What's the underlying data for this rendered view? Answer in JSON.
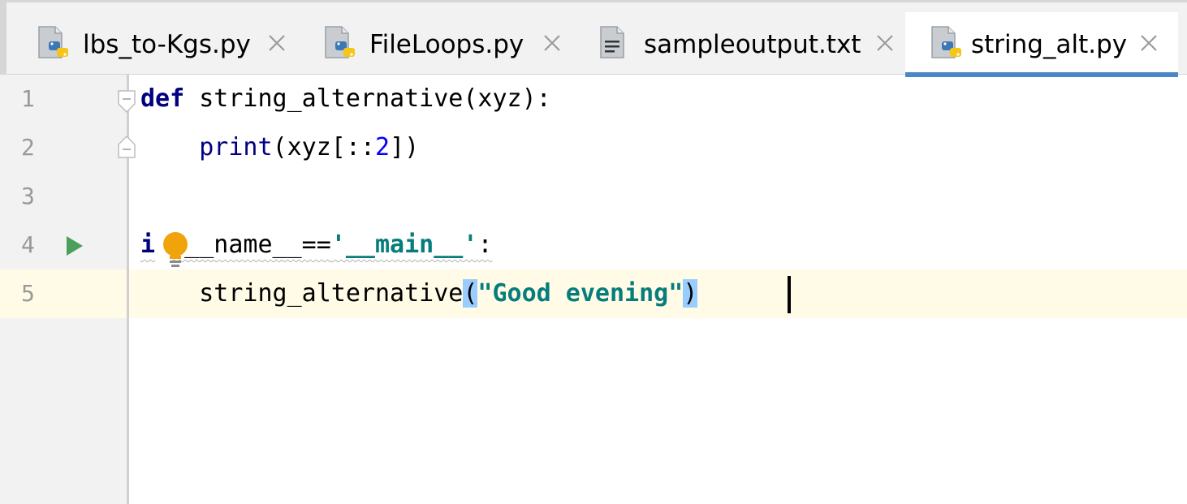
{
  "tabs": [
    {
      "label": "lbs_to-Kgs.py",
      "icon": "python-file-icon",
      "active": false
    },
    {
      "label": "FileLoops.py",
      "icon": "python-file-icon",
      "active": false
    },
    {
      "label": "sampleoutput.txt",
      "icon": "text-file-icon",
      "active": false
    },
    {
      "label": "string_alt.py",
      "icon": "python-file-icon",
      "active": true
    }
  ],
  "editor": {
    "line_numbers": [
      "1",
      "2",
      "3",
      "4",
      "5"
    ],
    "current_line": 5,
    "lines": {
      "l1": {
        "kw": "def",
        "rest": " string_alternative(xyz):"
      },
      "l2": {
        "indent": "    ",
        "builtin": "print",
        "pre": "(xyz[::",
        "num": "2",
        "post": "])"
      },
      "l3": "",
      "l4": {
        "kw_a": "i",
        "kw_b": "f",
        "mid": " __name__==",
        "str": "'__main__'",
        "post": ":"
      },
      "l5": {
        "indent": "    ",
        "fn": "string_alternative",
        "open": "(",
        "str": "\"Good evening\"",
        "close": ")"
      }
    }
  },
  "colors": {
    "keyword": "#000080",
    "string": "#067d7c",
    "number": "#0000ff",
    "active_tab_underline": "#4a87c9",
    "current_line": "#fffbe6",
    "brace_match": "#99ccff"
  }
}
